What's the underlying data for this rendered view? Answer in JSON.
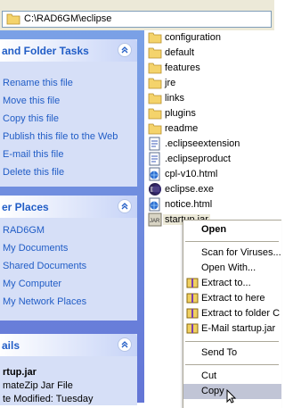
{
  "address": {
    "path": "C:\\RAD6GM\\eclipse"
  },
  "tasks": {
    "title": "and Folder Tasks",
    "items": [
      "Rename this file",
      "Move this file",
      "Copy this file",
      "Publish this file to the Web",
      "E-mail this file",
      "Delete this file"
    ]
  },
  "places": {
    "title": "er Places",
    "items": [
      "RAD6GM",
      "My Documents",
      "Shared Documents",
      "My Computer",
      "My Network Places"
    ]
  },
  "details": {
    "title": "ails",
    "name": "rtup.jar",
    "type": "mateZip Jar File",
    "modified": "te Modified: Tuesday"
  },
  "files": [
    {
      "name": "configuration",
      "icon": "folder-icon"
    },
    {
      "name": "default",
      "icon": "folder-icon"
    },
    {
      "name": "features",
      "icon": "folder-icon"
    },
    {
      "name": "jre",
      "icon": "folder-icon"
    },
    {
      "name": "links",
      "icon": "folder-icon"
    },
    {
      "name": "plugins",
      "icon": "folder-icon"
    },
    {
      "name": "readme",
      "icon": "folder-icon"
    },
    {
      "name": ".eclipseextension",
      "icon": "config-file-icon"
    },
    {
      "name": ".eclipseproduct",
      "icon": "config-file-icon"
    },
    {
      "name": "cpl-v10.html",
      "icon": "html-file-icon"
    },
    {
      "name": "eclipse.exe",
      "icon": "eclipse-exe-icon"
    },
    {
      "name": "notice.html",
      "icon": "html-file-icon"
    },
    {
      "name": "startup.jar",
      "icon": "jar-file-icon"
    }
  ],
  "menu": {
    "open": "Open",
    "scan": "Scan for Viruses...",
    "open_with": "Open With...",
    "extract_to": "Extract to...",
    "extract_here": "Extract to here",
    "extract_folder": "Extract to folder C",
    "email": "E-Mail startup.jar",
    "send_to": "Send To",
    "cut": "Cut",
    "copy": "Copy"
  },
  "colors": {
    "task_link": "#215dc6",
    "pane_bg": "#7aa1e6",
    "menu_highlight": "#c1c5d6"
  }
}
